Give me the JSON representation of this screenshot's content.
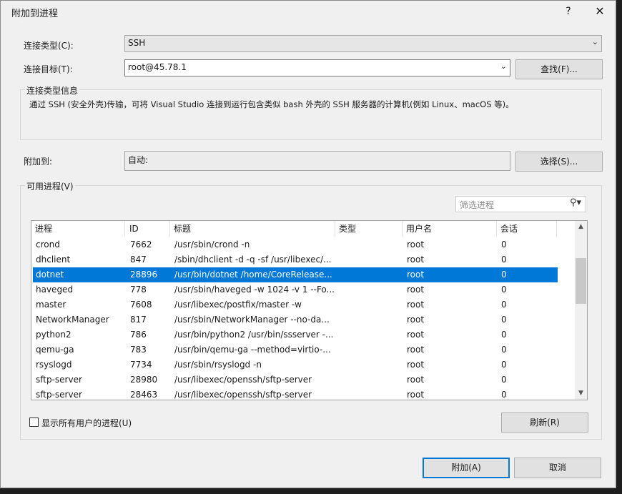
{
  "dialog": {
    "title": "附加到进程",
    "help_glyph": "?",
    "close_glyph": "✕"
  },
  "connection": {
    "type_label": "连接类型(C):",
    "type_value": "SSH",
    "target_label": "连接目标(T):",
    "target_value": "root@45.78.1",
    "find_button": "查找(F)..."
  },
  "info": {
    "group_title": "连接类型信息",
    "text": "通过 SSH (安全外壳)传输，可将 Visual Studio 连接到运行包含类似 bash 外壳的 SSH 服务器的计算机(例如 Linux、macOS 等)。"
  },
  "attach": {
    "label": "附加到:",
    "value": "自动:",
    "select_button": "选择(S)..."
  },
  "processes": {
    "group_title": "可用进程(V)",
    "filter_placeholder": "筛选进程",
    "columns": [
      "进程",
      "ID",
      "标题",
      "类型",
      "用户名",
      "会话"
    ],
    "rows": [
      {
        "name": "crond",
        "id": "7662",
        "title": "/usr/sbin/crond -n",
        "type": "",
        "user": "root",
        "session": "0"
      },
      {
        "name": "dhclient",
        "id": "847",
        "title": "/sbin/dhclient -d -q -sf /usr/libexec/...",
        "type": "",
        "user": "root",
        "session": "0"
      },
      {
        "name": "dotnet",
        "id": "28896",
        "title": "/usr/bin/dotnet /home/CoreRelease...",
        "type": "",
        "user": "root",
        "session": "0"
      },
      {
        "name": "haveged",
        "id": "778",
        "title": "/usr/sbin/haveged -w 1024 -v 1 --Fo...",
        "type": "",
        "user": "root",
        "session": "0"
      },
      {
        "name": "master",
        "id": "7608",
        "title": "/usr/libexec/postfix/master -w",
        "type": "",
        "user": "root",
        "session": "0"
      },
      {
        "name": "NetworkManager",
        "id": "817",
        "title": "/usr/sbin/NetworkManager --no-da...",
        "type": "",
        "user": "root",
        "session": "0"
      },
      {
        "name": "python2",
        "id": "786",
        "title": "/usr/bin/python2 /usr/bin/ssserver -...",
        "type": "",
        "user": "root",
        "session": "0"
      },
      {
        "name": "qemu-ga",
        "id": "783",
        "title": "/usr/bin/qemu-ga --method=virtio-...",
        "type": "",
        "user": "root",
        "session": "0"
      },
      {
        "name": "rsyslogd",
        "id": "7734",
        "title": "/usr/sbin/rsyslogd -n",
        "type": "",
        "user": "root",
        "session": "0"
      },
      {
        "name": "sftp-server",
        "id": "28980",
        "title": "/usr/libexec/openssh/sftp-server",
        "type": "",
        "user": "root",
        "session": "0"
      },
      {
        "name": "sftp-server",
        "id": "28463",
        "title": "/usr/libexec/openssh/sftp-server",
        "type": "",
        "user": "root",
        "session": "0"
      }
    ],
    "selected_index": 2,
    "show_all_label": "显示所有用户的进程(U)",
    "refresh_button": "刷新(R)"
  },
  "footer": {
    "attach_button": "附加(A)",
    "cancel_button": "取消"
  },
  "colors": {
    "selection": "#0078d7",
    "dialog_bg": "#f0f0f0"
  }
}
